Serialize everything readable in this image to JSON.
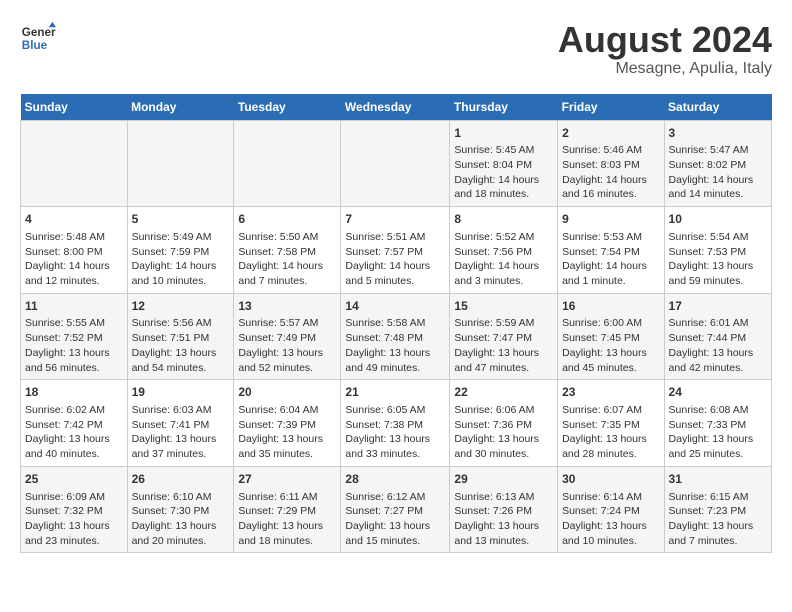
{
  "header": {
    "logo_line1": "General",
    "logo_line2": "Blue",
    "month": "August 2024",
    "location": "Mesagne, Apulia, Italy"
  },
  "weekdays": [
    "Sunday",
    "Monday",
    "Tuesday",
    "Wednesday",
    "Thursday",
    "Friday",
    "Saturday"
  ],
  "weeks": [
    [
      {
        "day": "",
        "info": ""
      },
      {
        "day": "",
        "info": ""
      },
      {
        "day": "",
        "info": ""
      },
      {
        "day": "",
        "info": ""
      },
      {
        "day": "1",
        "info": "Sunrise: 5:45 AM\nSunset: 8:04 PM\nDaylight: 14 hours\nand 18 minutes."
      },
      {
        "day": "2",
        "info": "Sunrise: 5:46 AM\nSunset: 8:03 PM\nDaylight: 14 hours\nand 16 minutes."
      },
      {
        "day": "3",
        "info": "Sunrise: 5:47 AM\nSunset: 8:02 PM\nDaylight: 14 hours\nand 14 minutes."
      }
    ],
    [
      {
        "day": "4",
        "info": "Sunrise: 5:48 AM\nSunset: 8:00 PM\nDaylight: 14 hours\nand 12 minutes."
      },
      {
        "day": "5",
        "info": "Sunrise: 5:49 AM\nSunset: 7:59 PM\nDaylight: 14 hours\nand 10 minutes."
      },
      {
        "day": "6",
        "info": "Sunrise: 5:50 AM\nSunset: 7:58 PM\nDaylight: 14 hours\nand 7 minutes."
      },
      {
        "day": "7",
        "info": "Sunrise: 5:51 AM\nSunset: 7:57 PM\nDaylight: 14 hours\nand 5 minutes."
      },
      {
        "day": "8",
        "info": "Sunrise: 5:52 AM\nSunset: 7:56 PM\nDaylight: 14 hours\nand 3 minutes."
      },
      {
        "day": "9",
        "info": "Sunrise: 5:53 AM\nSunset: 7:54 PM\nDaylight: 14 hours\nand 1 minute."
      },
      {
        "day": "10",
        "info": "Sunrise: 5:54 AM\nSunset: 7:53 PM\nDaylight: 13 hours\nand 59 minutes."
      }
    ],
    [
      {
        "day": "11",
        "info": "Sunrise: 5:55 AM\nSunset: 7:52 PM\nDaylight: 13 hours\nand 56 minutes."
      },
      {
        "day": "12",
        "info": "Sunrise: 5:56 AM\nSunset: 7:51 PM\nDaylight: 13 hours\nand 54 minutes."
      },
      {
        "day": "13",
        "info": "Sunrise: 5:57 AM\nSunset: 7:49 PM\nDaylight: 13 hours\nand 52 minutes."
      },
      {
        "day": "14",
        "info": "Sunrise: 5:58 AM\nSunset: 7:48 PM\nDaylight: 13 hours\nand 49 minutes."
      },
      {
        "day": "15",
        "info": "Sunrise: 5:59 AM\nSunset: 7:47 PM\nDaylight: 13 hours\nand 47 minutes."
      },
      {
        "day": "16",
        "info": "Sunrise: 6:00 AM\nSunset: 7:45 PM\nDaylight: 13 hours\nand 45 minutes."
      },
      {
        "day": "17",
        "info": "Sunrise: 6:01 AM\nSunset: 7:44 PM\nDaylight: 13 hours\nand 42 minutes."
      }
    ],
    [
      {
        "day": "18",
        "info": "Sunrise: 6:02 AM\nSunset: 7:42 PM\nDaylight: 13 hours\nand 40 minutes."
      },
      {
        "day": "19",
        "info": "Sunrise: 6:03 AM\nSunset: 7:41 PM\nDaylight: 13 hours\nand 37 minutes."
      },
      {
        "day": "20",
        "info": "Sunrise: 6:04 AM\nSunset: 7:39 PM\nDaylight: 13 hours\nand 35 minutes."
      },
      {
        "day": "21",
        "info": "Sunrise: 6:05 AM\nSunset: 7:38 PM\nDaylight: 13 hours\nand 33 minutes."
      },
      {
        "day": "22",
        "info": "Sunrise: 6:06 AM\nSunset: 7:36 PM\nDaylight: 13 hours\nand 30 minutes."
      },
      {
        "day": "23",
        "info": "Sunrise: 6:07 AM\nSunset: 7:35 PM\nDaylight: 13 hours\nand 28 minutes."
      },
      {
        "day": "24",
        "info": "Sunrise: 6:08 AM\nSunset: 7:33 PM\nDaylight: 13 hours\nand 25 minutes."
      }
    ],
    [
      {
        "day": "25",
        "info": "Sunrise: 6:09 AM\nSunset: 7:32 PM\nDaylight: 13 hours\nand 23 minutes."
      },
      {
        "day": "26",
        "info": "Sunrise: 6:10 AM\nSunset: 7:30 PM\nDaylight: 13 hours\nand 20 minutes."
      },
      {
        "day": "27",
        "info": "Sunrise: 6:11 AM\nSunset: 7:29 PM\nDaylight: 13 hours\nand 18 minutes."
      },
      {
        "day": "28",
        "info": "Sunrise: 6:12 AM\nSunset: 7:27 PM\nDaylight: 13 hours\nand 15 minutes."
      },
      {
        "day": "29",
        "info": "Sunrise: 6:13 AM\nSunset: 7:26 PM\nDaylight: 13 hours\nand 13 minutes."
      },
      {
        "day": "30",
        "info": "Sunrise: 6:14 AM\nSunset: 7:24 PM\nDaylight: 13 hours\nand 10 minutes."
      },
      {
        "day": "31",
        "info": "Sunrise: 6:15 AM\nSunset: 7:23 PM\nDaylight: 13 hours\nand 7 minutes."
      }
    ]
  ]
}
